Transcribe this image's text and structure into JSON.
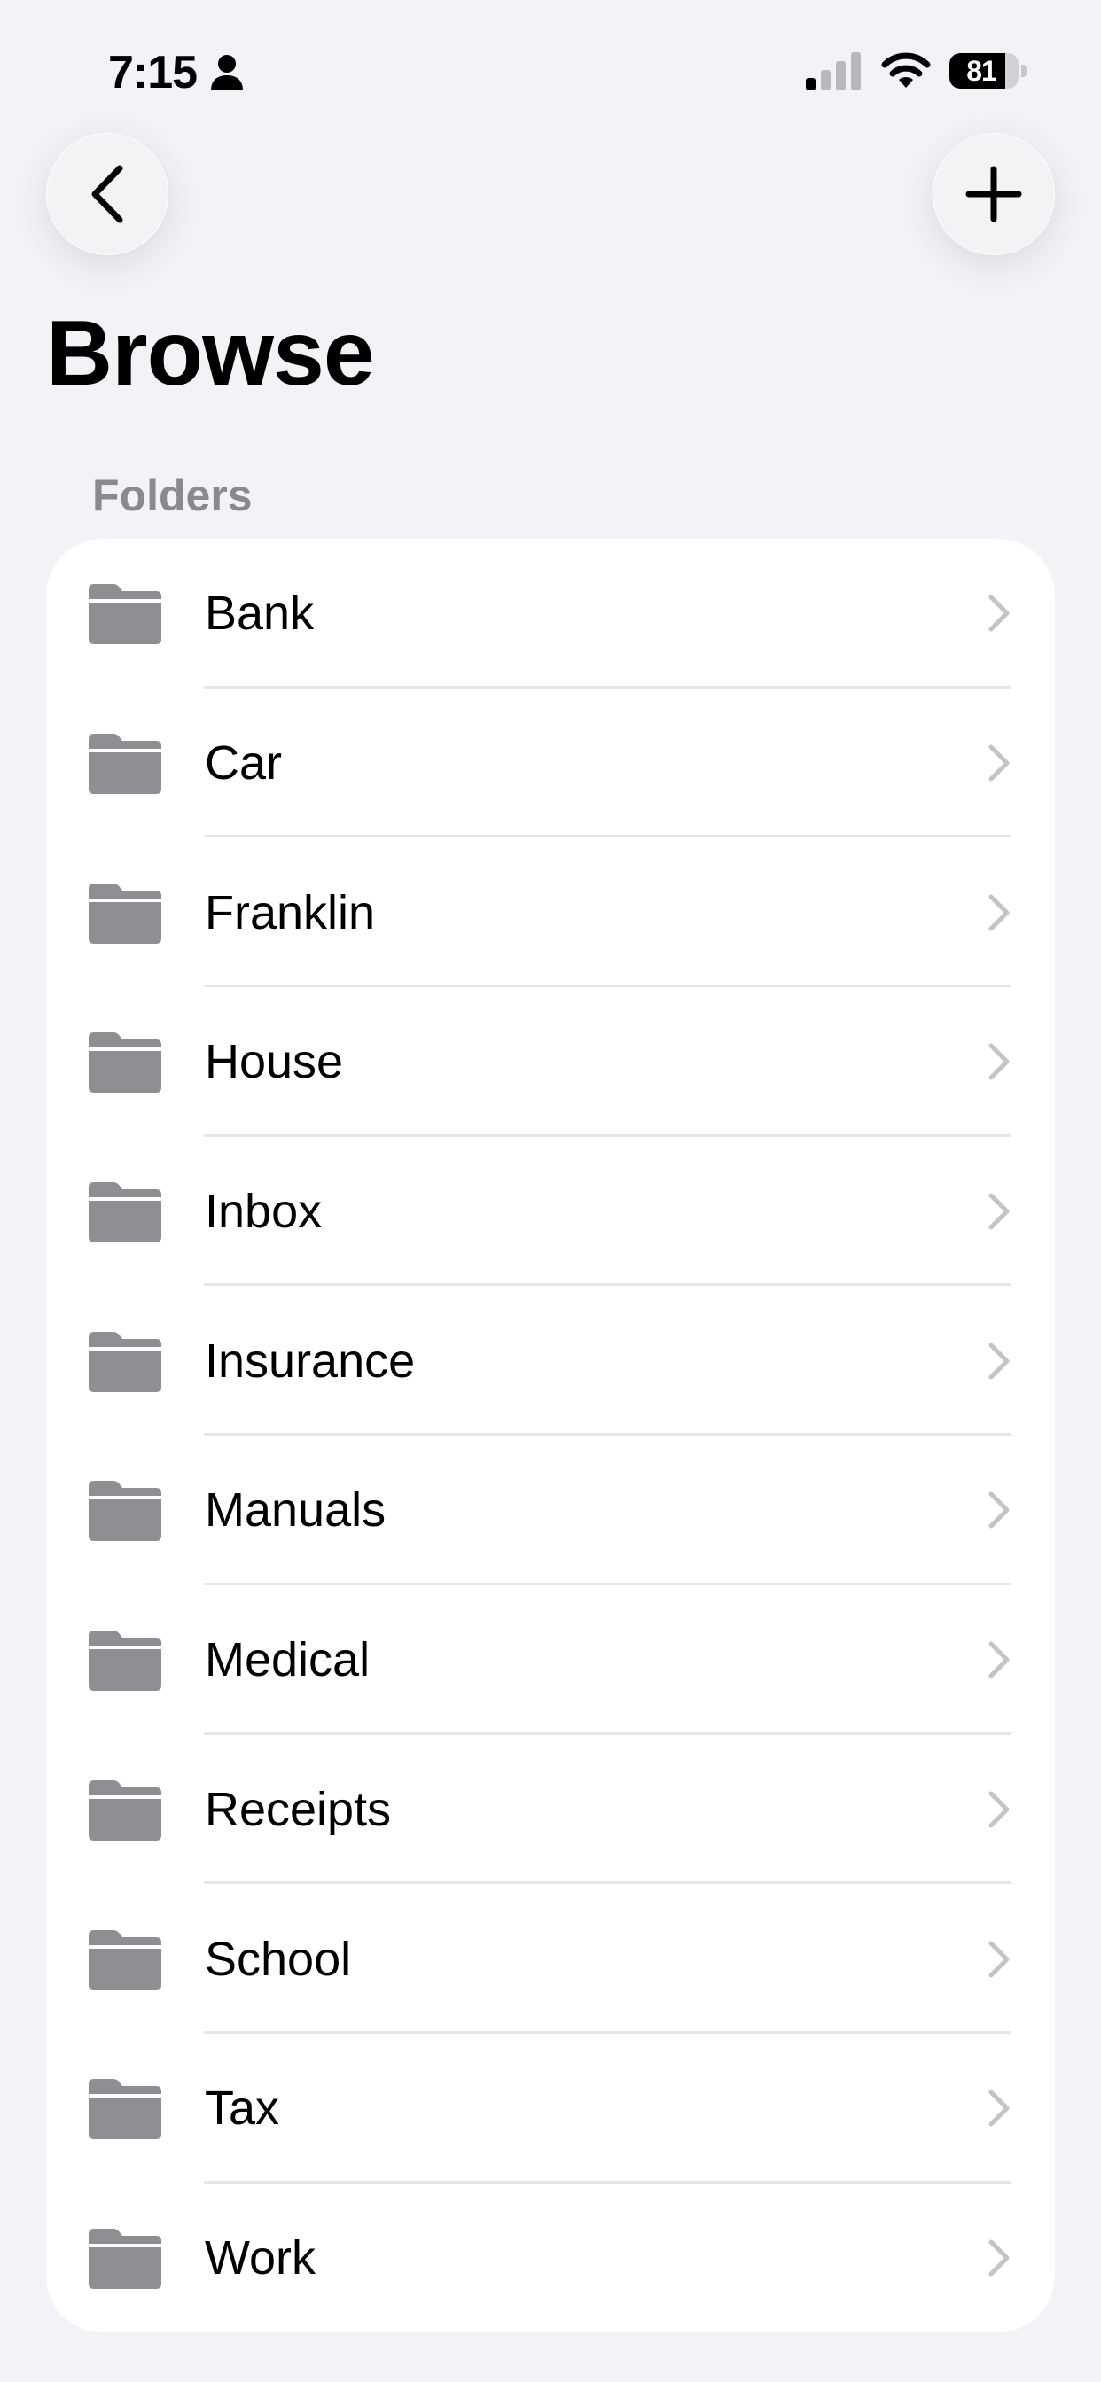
{
  "status_bar": {
    "time": "7:15",
    "battery_level": "81",
    "battery_fraction": 0.81,
    "person_icon": "person-icon",
    "signal_icon": "cellular-signal-icon",
    "wifi_icon": "wifi-icon"
  },
  "navigation": {
    "back_icon": "chevron-left-icon",
    "add_icon": "plus-icon"
  },
  "page": {
    "title": "Browse"
  },
  "folders": {
    "header": "Folders",
    "items": [
      {
        "label": "Bank"
      },
      {
        "label": "Car"
      },
      {
        "label": "Franklin"
      },
      {
        "label": "House"
      },
      {
        "label": "Inbox"
      },
      {
        "label": "Insurance"
      },
      {
        "label": "Manuals"
      },
      {
        "label": "Medical"
      },
      {
        "label": "Receipts"
      },
      {
        "label": "School"
      },
      {
        "label": "Tax"
      },
      {
        "label": "Work"
      }
    ]
  },
  "colors": {
    "background": "#f2f2f7",
    "card": "#ffffff",
    "folder_icon": "#8e8e93",
    "chevron": "#c4c4c7",
    "section_header": "#8a8a8e",
    "divider": "#e5e5ea"
  }
}
